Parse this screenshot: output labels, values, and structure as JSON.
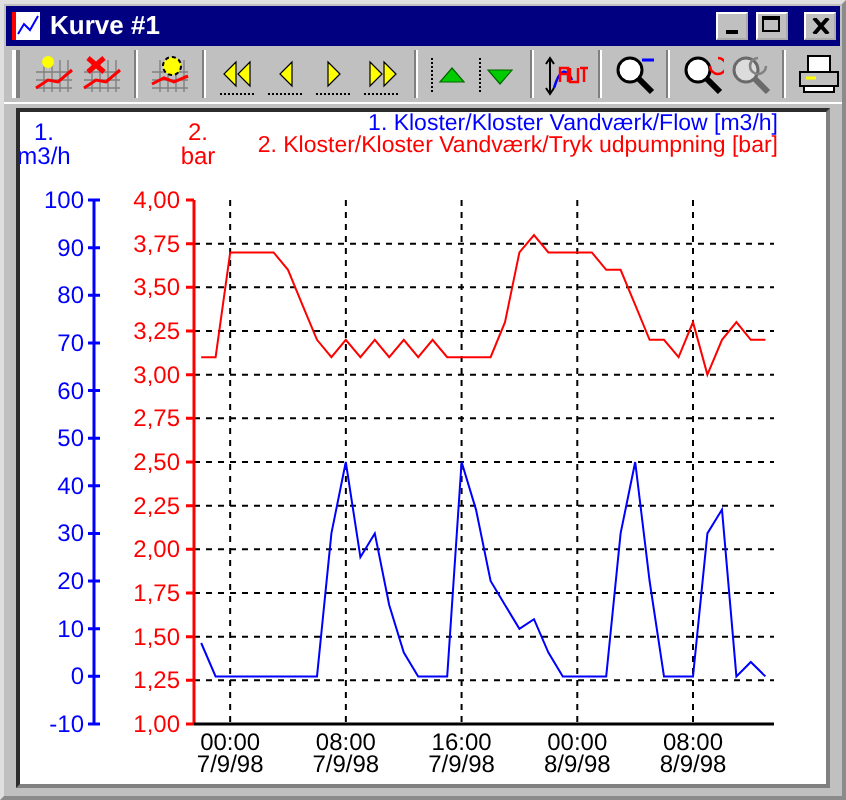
{
  "window": {
    "title": "Kurve #1"
  },
  "toolbar": [
    [
      {
        "kind": "new-curve",
        "disabled": false
      },
      {
        "kind": "delete-curve",
        "disabled": false
      }
    ],
    [
      {
        "kind": "curve-setup",
        "disabled": false
      }
    ],
    [
      {
        "kind": "first",
        "disabled": false
      },
      {
        "kind": "previous",
        "disabled": false
      },
      {
        "kind": "next",
        "disabled": false
      },
      {
        "kind": "last",
        "disabled": false
      }
    ],
    [
      {
        "kind": "up",
        "disabled": false
      },
      {
        "kind": "down",
        "disabled": false
      }
    ],
    [
      {
        "kind": "autoscale",
        "disabled": false
      }
    ],
    [
      {
        "kind": "zoom-out",
        "disabled": false
      }
    ],
    [
      {
        "kind": "zoom-undo",
        "disabled": false
      },
      {
        "kind": "zoom-redo",
        "disabled": true
      }
    ],
    [
      {
        "kind": "print",
        "disabled": false
      }
    ]
  ],
  "chart_data": {
    "type": "line",
    "grid": true,
    "ylabel": "1.\nm3/h",
    "y2label": "2.\nbar",
    "ylim": [
      -10,
      100
    ],
    "yticks": [
      -10,
      0,
      10,
      20,
      30,
      40,
      50,
      60,
      70,
      80,
      90,
      100
    ],
    "y2lim": [
      1,
      4
    ],
    "y2ticks": [
      {
        "value": 1,
        "label": "1,00"
      },
      {
        "value": 1.25,
        "label": "1,25"
      },
      {
        "value": 1.5,
        "label": "1,50"
      },
      {
        "value": 1.75,
        "label": "1,75"
      },
      {
        "value": 2,
        "label": "2,00"
      },
      {
        "value": 2.25,
        "label": "2,25"
      },
      {
        "value": 2.5,
        "label": "2,50"
      },
      {
        "value": 2.75,
        "label": "2,75"
      },
      {
        "value": 3,
        "label": "3,00"
      },
      {
        "value": 3.25,
        "label": "3,25"
      },
      {
        "value": 3.5,
        "label": "3,50"
      },
      {
        "value": 3.75,
        "label": "3,75"
      },
      {
        "value": 4,
        "label": "4,00"
      }
    ],
    "categories": [
      null,
      null,
      "00:00\n7/9/98",
      null,
      null,
      null,
      null,
      null,
      null,
      null,
      "08:00\n7/9/98",
      null,
      null,
      null,
      null,
      null,
      null,
      null,
      "16:00\n7/9/98",
      null,
      null,
      null,
      null,
      null,
      null,
      null,
      "00:00\n8/9/98",
      null,
      null,
      null,
      null,
      null,
      null,
      null,
      "08:00\n8/9/98",
      null,
      null,
      null,
      null,
      null
    ],
    "series": [
      {
        "name": "1. Kloster/Kloster Vandværk/Flow [m3/h]",
        "color": "#0000ff",
        "values": [
          7,
          0,
          0,
          0,
          0,
          0,
          0,
          0,
          0,
          30,
          45,
          25,
          30,
          15,
          5,
          0,
          0,
          0,
          45,
          35,
          20,
          15,
          10,
          12,
          5,
          0,
          0,
          0,
          0,
          30,
          45,
          20,
          0,
          0,
          0,
          30,
          35,
          0,
          3,
          0
        ]
      },
      {
        "name": "2. Kloster/Kloster Vandværk/Tryk udpumpning [bar]",
        "color": "#ff0000",
        "axis": "y2",
        "values": [
          3.1,
          3.1,
          3.7,
          3.7,
          3.7,
          3.7,
          3.6,
          3.4,
          3.2,
          3.1,
          3.2,
          3.1,
          3.2,
          3.1,
          3.2,
          3.1,
          3.2,
          3.1,
          3.1,
          3.1,
          3.1,
          3.3,
          3.7,
          3.8,
          3.7,
          3.7,
          3.7,
          3.7,
          3.6,
          3.6,
          3.4,
          3.2,
          3.2,
          3.1,
          3.3,
          3.0,
          3.2,
          3.3,
          3.2,
          3.2
        ]
      }
    ]
  }
}
